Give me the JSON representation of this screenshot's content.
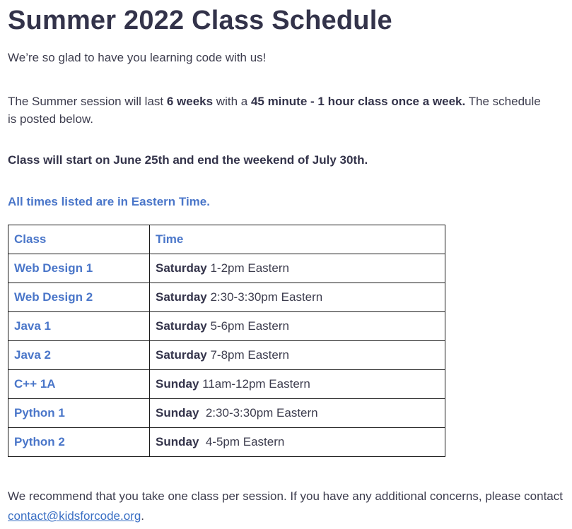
{
  "title": "Summer 2022 Class Schedule",
  "intro": "We’re so glad to have you learning code with us!",
  "session": {
    "t1": "The Summer session will last ",
    "b1": "6 weeks",
    "t2": " with a ",
    "b2": "45 minute - 1 hour class once a week.",
    "t3": " The schedule is posted below."
  },
  "dates_note": "Class will start on June 25th and end the weekend of July 30th.",
  "timezone_note": "All times listed are in Eastern Time.",
  "table": {
    "headers": [
      "Class",
      "Time"
    ],
    "rows": [
      {
        "cls": "Web Design 1",
        "day": "Saturday",
        "time": " 1-2pm Eastern"
      },
      {
        "cls": "Web Design 2",
        "day": "Saturday",
        "time": " 2:30-3:30pm Eastern"
      },
      {
        "cls": "Java 1",
        "day": "Saturday",
        "time": " 5-6pm Eastern"
      },
      {
        "cls": "Java 2",
        "day": "Saturday",
        "time": " 7-8pm Eastern"
      },
      {
        "cls": "C++ 1A",
        "day": "Sunday",
        "time": " 11am-12pm Eastern"
      },
      {
        "cls": "Python 1",
        "day": "Sunday",
        "time": "  2:30-3:30pm Eastern"
      },
      {
        "cls": "Python 2",
        "day": "Sunday",
        "time": "  4-5pm Eastern"
      }
    ]
  },
  "footer": {
    "text": "We recommend that you take one class per session. If you have any additional concerns, please contact ",
    "email": "contact@kidsforcode.org",
    "end": "."
  }
}
